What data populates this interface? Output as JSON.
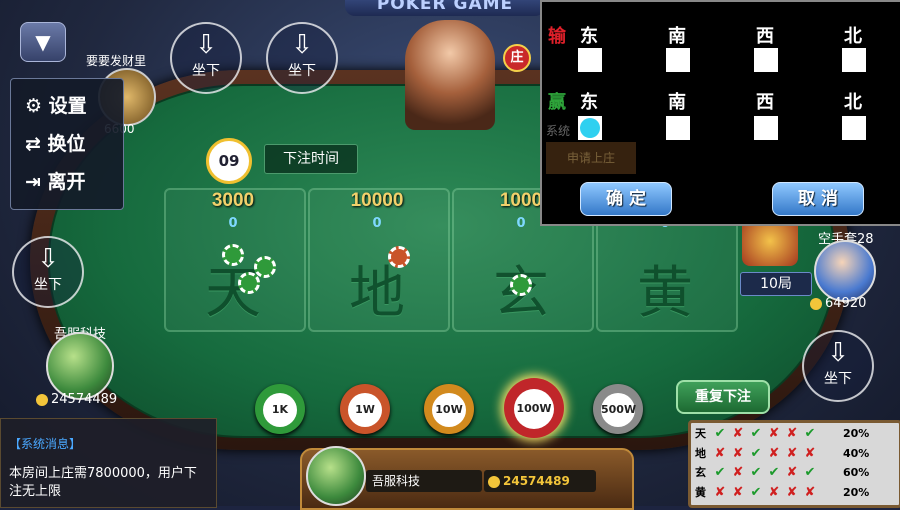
{
  "header": {
    "banner": "POKER    GAME"
  },
  "menu": {
    "settings": "设置",
    "swap_seat": "换位",
    "leave": "离开"
  },
  "seat_buttons": {
    "label": "坐下"
  },
  "timer": {
    "value": "09",
    "label": "下注时间"
  },
  "dealer_badge": "庄",
  "zones": [
    {
      "amount": "3000",
      "bet": "0",
      "char": "天"
    },
    {
      "amount": "10000",
      "bet": "0",
      "char": "地"
    },
    {
      "amount": "1000",
      "bet": "0",
      "char": "玄"
    },
    {
      "amount": "",
      "bet": "0",
      "char": "黄"
    }
  ],
  "players": {
    "top_left": {
      "name": "要要发财里",
      "coins": "6600"
    },
    "left": {
      "name": "吾服科技",
      "coins": "24574489"
    },
    "right": {
      "name": "空手套28",
      "coins": "64920"
    }
  },
  "rounds": "10局",
  "chips": [
    {
      "label": "1K",
      "color": "#2f9a3a"
    },
    {
      "label": "1W",
      "color": "#c9542a"
    },
    {
      "label": "10W",
      "color": "#d28a1e"
    },
    {
      "label": "100W",
      "color": "#c0262a"
    },
    {
      "label": "500W",
      "color": "#8a8a8a"
    }
  ],
  "repeat_bet": "重复下注",
  "system_msg": {
    "title": "【系统消息】",
    "body": "本房间上庄需7800000，用户下注无上限"
  },
  "self": {
    "name": "吾服科技",
    "coins": "24574489"
  },
  "panel": {
    "lose": "输",
    "win": "赢",
    "dirs": [
      "东",
      "南",
      "西",
      "北"
    ],
    "confirm": "确 定",
    "cancel": "取 消",
    "bg_apply": "申请上庄",
    "bg_sys": "系统"
  },
  "stats": {
    "rows": [
      {
        "label": "天",
        "marks": [
          "ok",
          "no",
          "ok",
          "no",
          "no",
          "ok"
        ],
        "pct": "20%"
      },
      {
        "label": "地",
        "marks": [
          "no",
          "no",
          "ok",
          "no",
          "no",
          "no"
        ],
        "pct": "40%"
      },
      {
        "label": "玄",
        "marks": [
          "ok",
          "no",
          "ok",
          "ok",
          "no",
          "ok"
        ],
        "pct": "60%"
      },
      {
        "label": "黄",
        "marks": [
          "no",
          "no",
          "ok",
          "no",
          "no",
          "no"
        ],
        "pct": "20%"
      }
    ]
  },
  "colors": {
    "felt": "#166b3e",
    "accent_gold": "#f1d16b",
    "lose_red": "#e0202a",
    "win_green": "#2ea43a"
  }
}
